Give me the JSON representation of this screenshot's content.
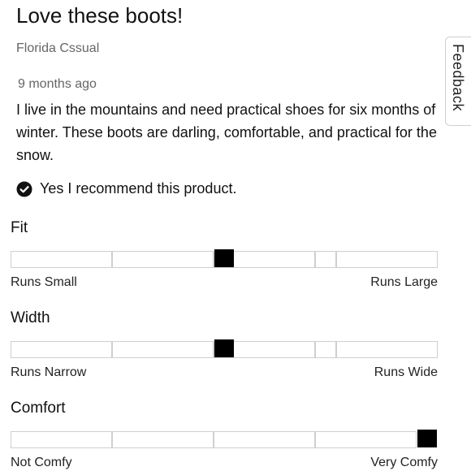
{
  "review": {
    "title": "Love these boots!",
    "author": "Florida Cssual",
    "date": "9 months ago",
    "body": "I live in the mountains and need practical shoes for six months of winter. These boots are darling, comfortable, and practical for the snow.",
    "recommend_text": "Yes I recommend this product.",
    "recommend_icon": "check-circle-icon"
  },
  "ratings": [
    {
      "title": "Fit",
      "left_label": "Runs Small",
      "right_label": "Runs Large",
      "position": 3,
      "of": 5
    },
    {
      "title": "Width",
      "left_label": "Runs Narrow",
      "right_label": "Runs Wide",
      "position": 3,
      "of": 5
    },
    {
      "title": "Comfort",
      "left_label": "Not Comfy",
      "right_label": "Very Comfy",
      "position": 5,
      "of": 5
    }
  ],
  "feedback_tab": {
    "label": "Feedback"
  },
  "colors": {
    "marker": "#000000",
    "segment_border": "#cfcfcf",
    "muted_text": "#666666"
  }
}
